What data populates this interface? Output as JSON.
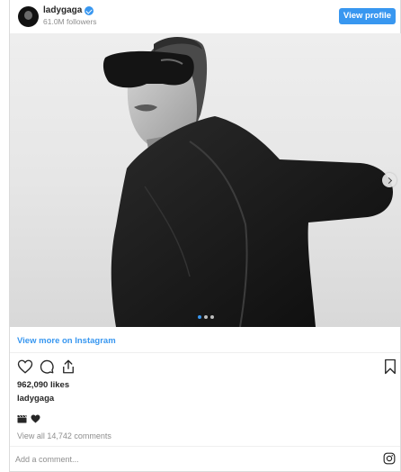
{
  "header": {
    "username": "ladygaga",
    "followers": "61.0M followers",
    "view_profile_label": "View profile"
  },
  "icons": {
    "avatar": "profile-avatar",
    "verified": "verified-badge-icon",
    "next": "chevron-right-icon",
    "like": "heart-icon",
    "comment": "comment-bubble-icon",
    "share": "share-icon",
    "save": "bookmark-icon",
    "emoji_1": "clapper-board-icon",
    "emoji_2": "black-heart-icon",
    "instagram": "instagram-icon"
  },
  "carousel": {
    "slide_count": 3,
    "active_slide": 1
  },
  "view_more_label": "View more on Instagram",
  "likes": "962,090 likes",
  "caption_user": "ladygaga",
  "view_comments": "View all 14,742 comments",
  "comment_placeholder": "Add a comment...",
  "colors": {
    "accent": "#3897f0",
    "text": "#262626",
    "muted": "#8e8e8e",
    "border": "#dbdbdb"
  }
}
